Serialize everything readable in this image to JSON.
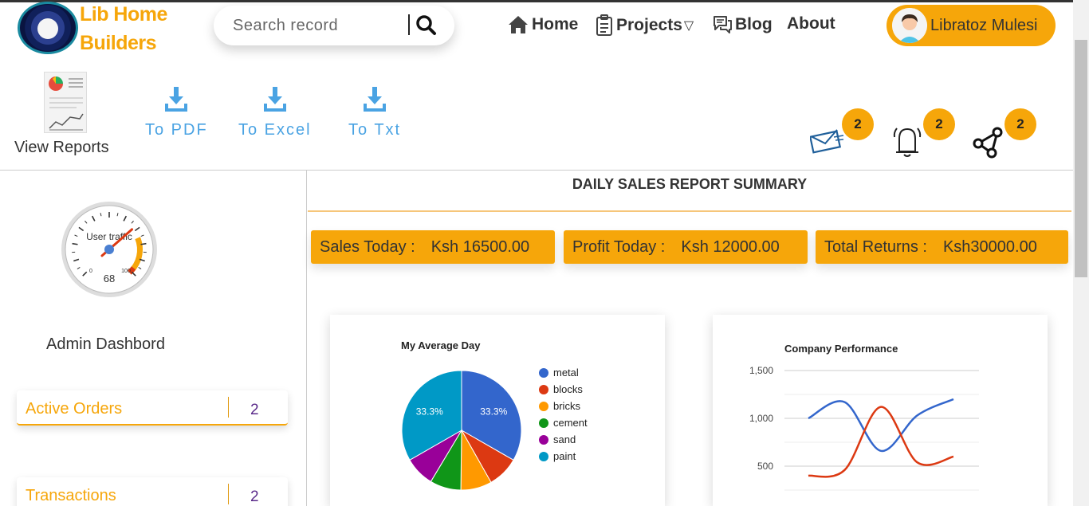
{
  "brand": {
    "line1": "Lib Home",
    "line2": "Builders"
  },
  "search": {
    "placeholder": "Search record"
  },
  "nav": {
    "home": "Home",
    "projects": "Projects",
    "projects_caret": "▽",
    "blog": "Blog",
    "about": "About"
  },
  "user": {
    "name": "Libratoz Mulesi"
  },
  "toolbar": {
    "view_reports": "View Reports",
    "to_pdf": "To PDF",
    "to_excel": "To Excel",
    "to_txt": "To Txt"
  },
  "notifications": {
    "messages": "2",
    "alerts": "2",
    "shares": "2"
  },
  "gauge": {
    "label": "User traffic",
    "value": "68",
    "min_label": "0",
    "max_label": "100",
    "value_num": 68
  },
  "sidebar": {
    "title": "Admin Dashbord",
    "cards": [
      {
        "label": "Active Orders",
        "value": "2"
      },
      {
        "label": "Transactions",
        "value": "2"
      }
    ]
  },
  "main": {
    "title": "DAILY SALES REPORT SUMMARY",
    "kpis": [
      {
        "label": "Sales Today :",
        "value": "Ksh 16500.00"
      },
      {
        "label": "Profit Today :",
        "value": "Ksh 12000.00"
      },
      {
        "label": "Total Returns :",
        "value": "Ksh30000.00"
      }
    ]
  },
  "colors": {
    "accent": "#f6a60a",
    "link": "#4aa3e3"
  },
  "chart_data": [
    {
      "type": "pie",
      "title": "My Average Day",
      "categories": [
        "metal",
        "blocks",
        "bricks",
        "cement",
        "sand",
        "paint"
      ],
      "values": [
        33.3,
        8.5,
        8.4,
        8.4,
        8.1,
        33.3
      ],
      "colors": [
        "#3366cc",
        "#dc3912",
        "#ff9900",
        "#109618",
        "#990099",
        "#0099c6"
      ],
      "slice_labels": [
        "33.3%",
        "",
        "",
        "",
        "",
        "33.3%"
      ],
      "legend": "right"
    },
    {
      "type": "line",
      "title": "Company Performance",
      "x": [
        0,
        1,
        2,
        3,
        4
      ],
      "series": [
        {
          "values": [
            1000,
            1170,
            660,
            1030,
            1200
          ],
          "color": "#3366cc"
        },
        {
          "values": [
            400,
            460,
            1120,
            540,
            600
          ],
          "color": "#dc3912"
        }
      ],
      "yticks": [
        "1,500",
        "1,000",
        "500"
      ],
      "ytick_values": [
        1500,
        1000,
        500
      ],
      "ylim": [
        300,
        1500
      ],
      "grid": true
    }
  ]
}
